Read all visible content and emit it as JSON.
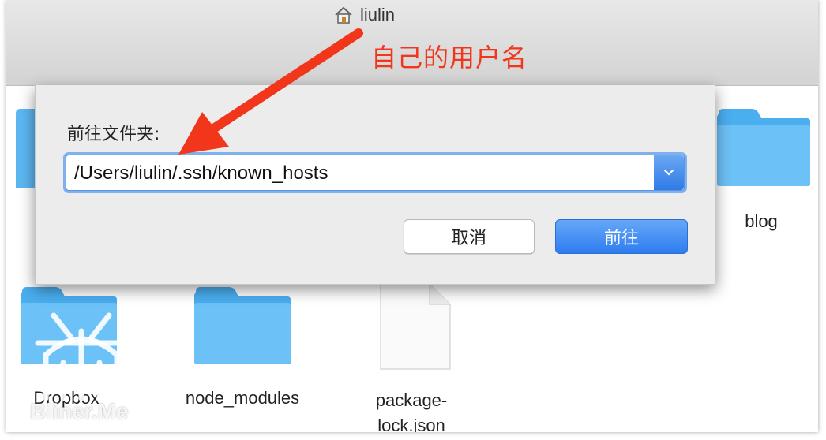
{
  "window": {
    "title": "liulin",
    "title_icon": "home-icon"
  },
  "annotation": {
    "text": "自己的用户名",
    "color": "#f2361c"
  },
  "dialog": {
    "label": "前往文件夹:",
    "path_value": "/Users/liulin/.ssh/known_hosts",
    "cancel_label": "取消",
    "go_label": "前往"
  },
  "files": [
    {
      "name": "blog",
      "icon": "folder-icon"
    },
    {
      "name": "Dropbox",
      "icon": "folder-icon"
    },
    {
      "name": "node_modules",
      "icon": "folder-icon"
    },
    {
      "name": "package-lock.json",
      "icon": "document-icon"
    }
  ],
  "watermark": {
    "text": "Bliner.Me"
  },
  "colors": {
    "folder": "#5cb7f1",
    "accent": "#2f7cf0",
    "annotation": "#f2361c"
  }
}
